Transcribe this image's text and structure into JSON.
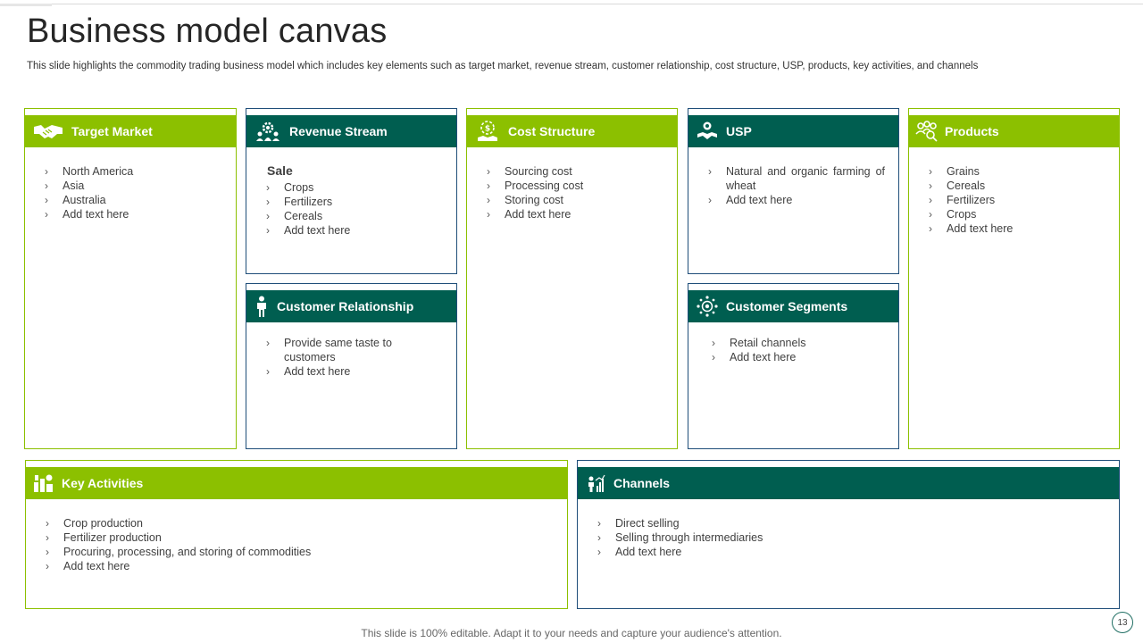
{
  "header": {
    "title": "Business model canvas",
    "subtitle": "This slide highlights the commodity trading business model which includes key elements such as target market, revenue stream, customer relationship, cost structure, USP, products, key activities, and channels"
  },
  "colors": {
    "green": "#8cc000",
    "teal": "#005e50",
    "border_teal": "#1f4e79"
  },
  "cards": {
    "target_market": {
      "title": "Target Market",
      "icon": "handshake-icon",
      "items": [
        "North America",
        "Asia",
        "Australia",
        "Add text here"
      ]
    },
    "revenue_stream": {
      "title": "Revenue Stream",
      "icon": "gear-group-icon",
      "heading": "Sale",
      "items": [
        "Crops",
        "Fertilizers",
        "Cereals",
        "Add text here"
      ]
    },
    "customer_relationship": {
      "title": "Customer Relationship",
      "icon": "person-icon",
      "items": [
        "Provide  same taste to customers",
        "Add text here"
      ]
    },
    "cost_structure": {
      "title": "Cost Structure",
      "icon": "money-hand-icon",
      "items": [
        "Sourcing cost",
        "Processing cost",
        "Storing cost",
        "Add text here"
      ]
    },
    "usp": {
      "title": "USP",
      "icon": "hand-award-icon",
      "items": [
        "Natural and organic farming of wheat",
        "Add text here"
      ]
    },
    "customer_segments": {
      "title": "Customer Segments",
      "icon": "target-group-icon",
      "items": [
        "Retail channels",
        "Add text here"
      ]
    },
    "products": {
      "title": "Products",
      "icon": "people-search-icon",
      "items": [
        "Grains",
        "Cereals",
        "Fertilizers",
        "Crops",
        "Add text here"
      ]
    },
    "key_activities": {
      "title": "Key Activities",
      "icon": "process-icon",
      "items": [
        "Crop production",
        "Fertilizer production",
        "Procuring,  processing,  and storing of commodities",
        "Add text here"
      ]
    },
    "channels": {
      "title": "Channels",
      "icon": "presenter-chart-icon",
      "items": [
        "Direct selling",
        "Selling through  intermediaries",
        "Add text here"
      ]
    }
  },
  "footer": {
    "text": "This slide is 100% editable. Adapt it to your needs and capture your audience's attention.",
    "page_number": "13"
  }
}
